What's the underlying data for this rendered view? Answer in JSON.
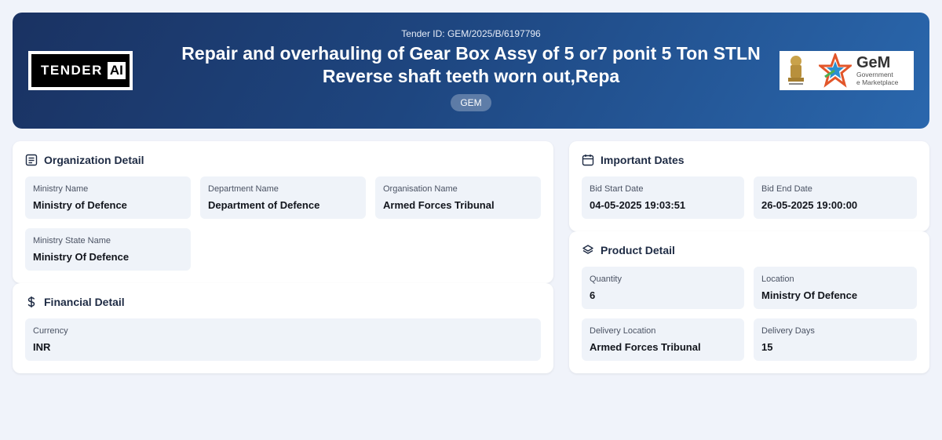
{
  "header": {
    "tender_id_label": "Tender ID: GEM/2025/B/6197796",
    "title": "Repair and overhauling of Gear Box Assy of 5 or7 ponit 5 Ton STLN Reverse shaft teeth worn out,Repa",
    "source_badge": "GEM",
    "left_logo": {
      "word": "TENDER",
      "suffix": "AI"
    },
    "right_logo": {
      "brand": "GeM",
      "line1": "Government",
      "line2": "e Marketplace"
    }
  },
  "organization": {
    "title": "Organization Detail",
    "icon": "document-icon",
    "fields": [
      {
        "label": "Ministry Name",
        "value": "Ministry of Defence"
      },
      {
        "label": "Department Name",
        "value": "Department of Defence"
      },
      {
        "label": "Organisation Name",
        "value": "Armed Forces Tribunal"
      },
      {
        "label": "Ministry State Name",
        "value": "Ministry Of Defence"
      }
    ]
  },
  "financial": {
    "title": "Financial Detail",
    "icon": "dollar-icon",
    "fields": [
      {
        "label": "Currency",
        "value": "INR"
      }
    ]
  },
  "dates": {
    "title": "Important Dates",
    "icon": "calendar-icon",
    "fields": [
      {
        "label": "Bid Start Date",
        "value": "04-05-2025 19:03:51"
      },
      {
        "label": "Bid End Date",
        "value": "26-05-2025 19:00:00"
      }
    ]
  },
  "product": {
    "title": "Product Detail",
    "icon": "layers-icon",
    "fields": [
      {
        "label": "Quantity",
        "value": "6"
      },
      {
        "label": "Location",
        "value": "Ministry Of Defence"
      },
      {
        "label": "Delivery Location",
        "value": "Armed Forces Tribunal"
      },
      {
        "label": "Delivery Days",
        "value": "15"
      }
    ]
  },
  "colors": {
    "page_bg": "#f0f3fa",
    "hero_start": "#1a3262",
    "hero_end": "#2a67ad",
    "field_bg": "#eff3f9"
  }
}
